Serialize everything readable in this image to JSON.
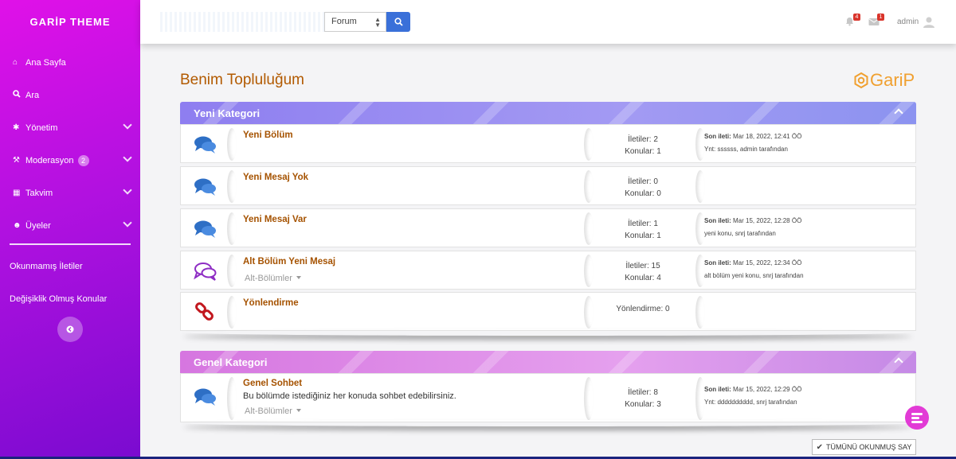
{
  "sidebar": {
    "brand": "GARİP THEME",
    "items": [
      {
        "label": "Ana Sayfa",
        "icon": "home-icon"
      },
      {
        "label": "Ara",
        "icon": "search-icon"
      },
      {
        "label": "Yönetim",
        "icon": "gear-icon"
      },
      {
        "label": "Moderasyon",
        "icon": "wrench-icon",
        "badge": "2"
      },
      {
        "label": "Takvim",
        "icon": "calendar-icon"
      },
      {
        "label": "Üyeler",
        "icon": "users-icon"
      }
    ],
    "unread_label": "Okunmamış İletiler",
    "changed_label": "Değişiklik Olmuş Konular"
  },
  "topbar": {
    "search_value": "",
    "select_value": "Forum",
    "notif_count": "4",
    "msg_count": "1",
    "username": "admin"
  },
  "page": {
    "title": "Benim Topluluğum",
    "logo_text": "GariP"
  },
  "categories": [
    {
      "title": "Yeni Kategori",
      "forums": [
        {
          "title": "Yeni Bölüm",
          "stats_line1": "İletiler: 2",
          "stats_line2": "Konular: 1",
          "last_label": "Son ileti:",
          "last_date": "Mar 18, 2022, 12:41 ÖÖ",
          "last_by": "Ynt: ssssss, admin tarafından"
        },
        {
          "title": "Yeni Mesaj Yok",
          "stats_line1": "İletiler: 0",
          "stats_line2": "Konular: 0"
        },
        {
          "title": "Yeni Mesaj Var",
          "stats_line1": "İletiler: 1",
          "stats_line2": "Konular: 1",
          "last_label": "Son ileti:",
          "last_date": "Mar 15, 2022, 12:28 ÖÖ",
          "last_by": "yeni konu, snrj tarafından"
        },
        {
          "title": "Alt Bölüm Yeni Mesaj",
          "subboards": "Alt-Bölümler",
          "stats_line1": "İletiler: 15",
          "stats_line2": "Konular: 4",
          "last_label": "Son ileti:",
          "last_date": "Mar 15, 2022, 12:34 ÖÖ",
          "last_by": "alt bölüm yeni konu, snrj tarafından"
        },
        {
          "title": "Yönlendirme",
          "stats_line1": "Yönlendirme: 0"
        }
      ]
    },
    {
      "title": "Genel Kategori",
      "forums": [
        {
          "title": "Genel Sohbet",
          "description": "Bu bölümde istediğiniz her konuda sohbet edebilirsiniz.",
          "subboards": "Alt-Bölümler",
          "stats_line1": "İletiler: 8",
          "stats_line2": "Konular: 3",
          "last_label": "Son ileti:",
          "last_date": "Mar 15, 2022, 12:29 ÖÖ",
          "last_by": "Ynt: dddddddddd, snrj tarafından"
        }
      ]
    }
  ],
  "actions": {
    "mark_all_read": "TÜMÜNÜ OKUNMUŞ SAY"
  },
  "colors": {
    "accent": "#3a70d9",
    "title": "#b25a00",
    "forum_link": "#a55200",
    "cat1": "#8e7ef0",
    "cat2": "#d676e0"
  }
}
